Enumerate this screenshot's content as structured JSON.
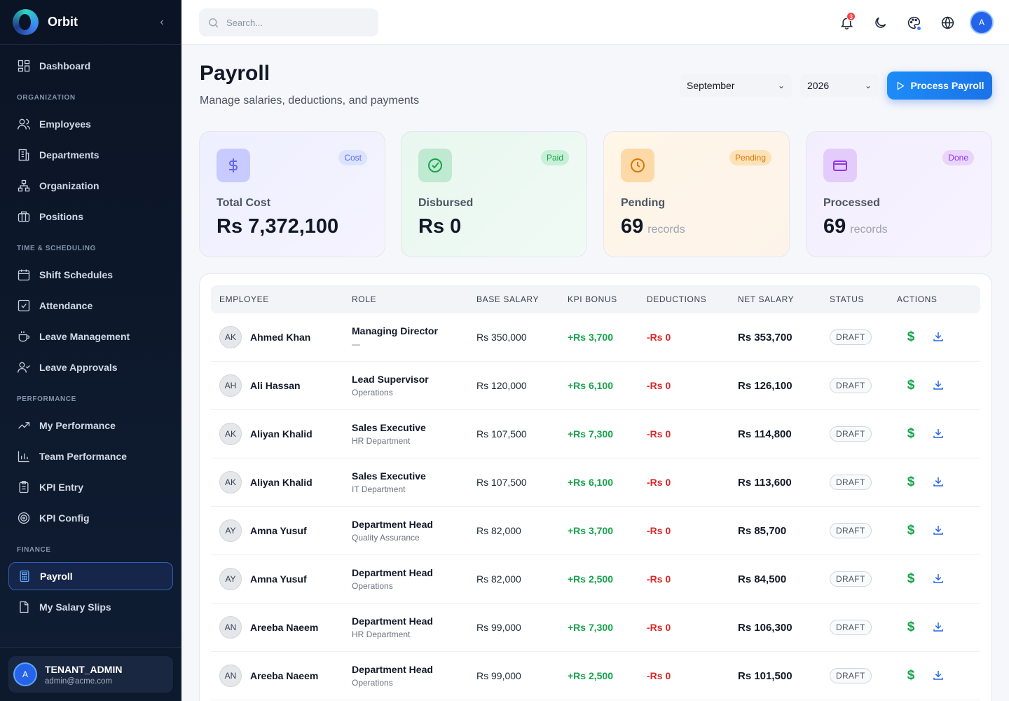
{
  "brand": {
    "name": "Orbit",
    "collapse_glyph": "‹"
  },
  "sidebar": {
    "top_items": [
      {
        "label": "Dashboard",
        "icon": "grid-icon"
      }
    ],
    "sections": [
      {
        "label": "ORGANIZATION",
        "items": [
          {
            "label": "Employees",
            "icon": "users-icon"
          },
          {
            "label": "Departments",
            "icon": "building-icon"
          },
          {
            "label": "Organization",
            "icon": "org-chart-icon"
          },
          {
            "label": "Positions",
            "icon": "briefcase-icon"
          }
        ]
      },
      {
        "label": "TIME & SCHEDULING",
        "items": [
          {
            "label": "Shift Schedules",
            "icon": "calendar-icon"
          },
          {
            "label": "Attendance",
            "icon": "checkbox-icon"
          },
          {
            "label": "Leave Management",
            "icon": "coffee-icon"
          },
          {
            "label": "Leave Approvals",
            "icon": "user-check-icon"
          }
        ]
      },
      {
        "label": "PERFORMANCE",
        "items": [
          {
            "label": "My Performance",
            "icon": "trend-icon"
          },
          {
            "label": "Team Performance",
            "icon": "bar-chart-icon"
          },
          {
            "label": "KPI Entry",
            "icon": "clipboard-icon"
          },
          {
            "label": "KPI Config",
            "icon": "target-icon"
          }
        ]
      },
      {
        "label": "FINANCE",
        "items": [
          {
            "label": "Payroll",
            "icon": "calculator-icon",
            "active": true
          },
          {
            "label": "My Salary Slips",
            "icon": "file-icon"
          }
        ]
      }
    ]
  },
  "user": {
    "initial": "A",
    "role": "TENANT_ADMIN",
    "email": "admin@acme.com"
  },
  "topbar": {
    "search_placeholder": "Search...",
    "notification_count": "3",
    "avatar_initial": "A"
  },
  "page": {
    "title": "Payroll",
    "subtitle": "Manage salaries, deductions, and payments",
    "month": "September",
    "year": "2026",
    "process_label": "Process Payroll"
  },
  "stats": [
    {
      "badge": "Cost",
      "label": "Total Cost",
      "value": "Rs 7,372,100",
      "unit": "",
      "color": "#6366f1"
    },
    {
      "badge": "Paid",
      "label": "Disbursed",
      "value": "Rs 0",
      "unit": "",
      "color": "#16a34a"
    },
    {
      "badge": "Pending",
      "label": "Pending",
      "value": "69",
      "unit": "records",
      "color": "#d97706"
    },
    {
      "badge": "Done",
      "label": "Processed",
      "value": "69",
      "unit": "records",
      "color": "#9333ea"
    }
  ],
  "table": {
    "headers": [
      "EMPLOYEE",
      "ROLE",
      "BASE SALARY",
      "KPI BONUS",
      "DEDUCTIONS",
      "NET SALARY",
      "STATUS",
      "ACTIONS"
    ],
    "rows": [
      {
        "initials": "AK",
        "name": "Ahmed Khan",
        "role": "Managing Director",
        "dept": "—",
        "base": "Rs 350,000",
        "kpi": "+Rs 3,700",
        "ded": "-Rs 0",
        "net": "Rs 353,700",
        "status": "DRAFT"
      },
      {
        "initials": "AH",
        "name": "Ali Hassan",
        "role": "Lead Supervisor",
        "dept": "Operations",
        "base": "Rs 120,000",
        "kpi": "+Rs 6,100",
        "ded": "-Rs 0",
        "net": "Rs 126,100",
        "status": "DRAFT"
      },
      {
        "initials": "AK",
        "name": "Aliyan Khalid",
        "role": "Sales Executive",
        "dept": "HR Department",
        "base": "Rs 107,500",
        "kpi": "+Rs 7,300",
        "ded": "-Rs 0",
        "net": "Rs 114,800",
        "status": "DRAFT"
      },
      {
        "initials": "AK",
        "name": "Aliyan Khalid",
        "role": "Sales Executive",
        "dept": "IT Department",
        "base": "Rs 107,500",
        "kpi": "+Rs 6,100",
        "ded": "-Rs 0",
        "net": "Rs 113,600",
        "status": "DRAFT"
      },
      {
        "initials": "AY",
        "name": "Amna Yusuf",
        "role": "Department Head",
        "dept": "Quality Assurance",
        "base": "Rs 82,000",
        "kpi": "+Rs 3,700",
        "ded": "-Rs 0",
        "net": "Rs 85,700",
        "status": "DRAFT"
      },
      {
        "initials": "AY",
        "name": "Amna Yusuf",
        "role": "Department Head",
        "dept": "Operations",
        "base": "Rs 82,000",
        "kpi": "+Rs 2,500",
        "ded": "-Rs 0",
        "net": "Rs 84,500",
        "status": "DRAFT"
      },
      {
        "initials": "AN",
        "name": "Areeba Naeem",
        "role": "Department Head",
        "dept": "HR Department",
        "base": "Rs 99,000",
        "kpi": "+Rs 7,300",
        "ded": "-Rs 0",
        "net": "Rs 106,300",
        "status": "DRAFT"
      },
      {
        "initials": "AN",
        "name": "Areeba Naeem",
        "role": "Department Head",
        "dept": "Operations",
        "base": "Rs 99,000",
        "kpi": "+Rs 2,500",
        "ded": "-Rs 0",
        "net": "Rs 101,500",
        "status": "DRAFT"
      }
    ]
  }
}
